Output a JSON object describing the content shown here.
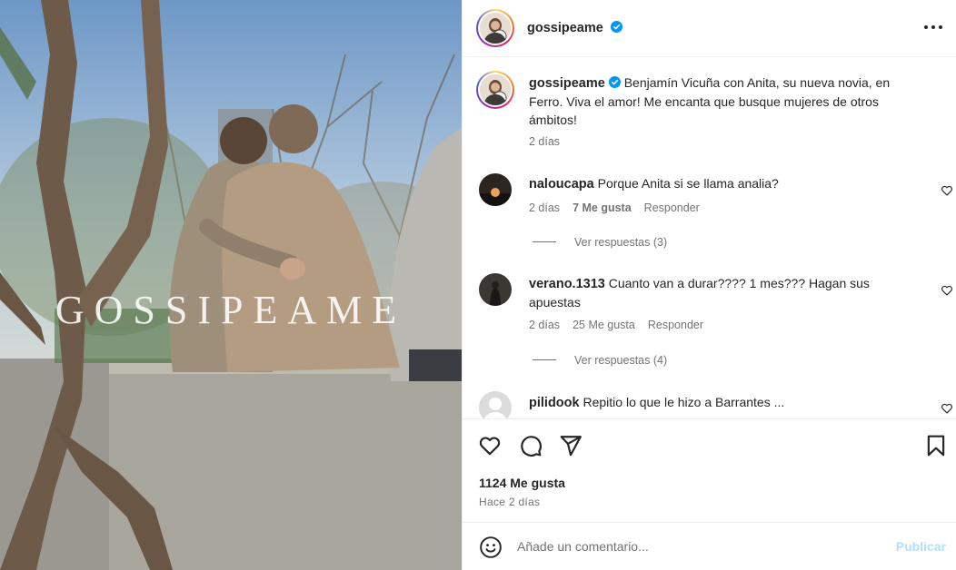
{
  "post": {
    "image_alt": "Pareja abrazada sentada sobre un muro",
    "watermark": "GOSSIPEAME"
  },
  "header": {
    "username": "gossipeame",
    "verified": true,
    "more_icon": "more-horizontal-icon"
  },
  "caption": {
    "username": "gossipeame",
    "text": "Benjamín Vicuña con Anita, su nueva novia, en Ferro. Viva el amor! Me encanta que busque mujeres de otros ámbitos!",
    "time": "2 días"
  },
  "comments": [
    {
      "username": "naloucapa",
      "text": "Porque Anita si se llama analia?",
      "time": "2 días",
      "likes": "7 Me gusta",
      "reply_label": "Responder",
      "view_replies": "Ver respuestas (3)"
    },
    {
      "username": "verano.1313",
      "text": "Cuanto van a durar???? 1 mes??? Hagan sus apuestas",
      "time": "2 días",
      "likes": "25 Me gusta",
      "reply_label": "Responder",
      "view_replies": "Ver respuestas (4)"
    },
    {
      "username": "pilidook",
      "text": "Repitio lo que le hizo a Barrantes ..."
    }
  ],
  "actions": {
    "likes_count": "1124 Me gusta",
    "posted": "Hace 2 días",
    "icons": [
      "heart-icon",
      "comment-icon",
      "share-icon",
      "bookmark-icon"
    ]
  },
  "add_comment": {
    "placeholder": "Añade un comentario...",
    "publish_label": "Publicar",
    "emoji_icon": "emoji-icon"
  },
  "colors": {
    "verified_blue": "#0095f6",
    "publish_disabled": "#b2dffc",
    "muted_text": "#737373"
  }
}
